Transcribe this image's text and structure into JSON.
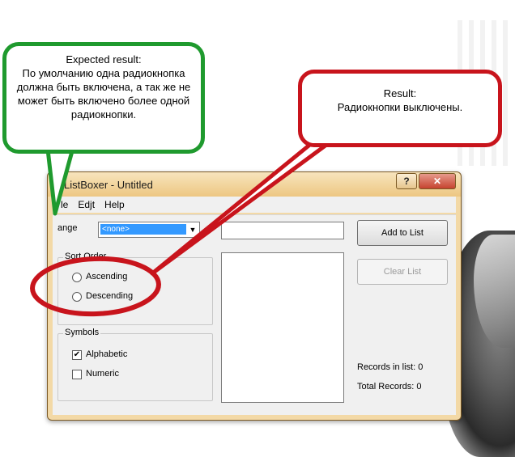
{
  "window": {
    "title": "ListBoxer - Untitled",
    "help_label": "?",
    "close_label": "✕",
    "menu": [
      {
        "label": "File",
        "visible_text": "le"
      },
      {
        "label": "Edit",
        "visible_text": "Edjt"
      },
      {
        "label": "Help",
        "visible_text": "Help"
      }
    ],
    "range_label": "ange",
    "range_value": "<none>",
    "sort_order": {
      "title": "Sort Order",
      "options": [
        "Ascending",
        "Descending"
      ]
    },
    "symbols": {
      "title": "Symbols",
      "options": [
        {
          "label": "Alphabetic",
          "checked": true
        },
        {
          "label": "Numeric",
          "checked": false
        }
      ]
    },
    "add_button": "Add to List",
    "clear_button": "Clear List",
    "records_in_list": "Records in list: 0",
    "total_records": "Total Records: 0"
  },
  "callouts": {
    "expected": {
      "title": "Expected result:",
      "text": "По умолчанию одна радиокнопка должна быть включена, а так же не может быть включено более одной радиокнопки."
    },
    "result": {
      "title": "Result:",
      "text": "Радиокнопки выключены."
    }
  },
  "colors": {
    "green": "#1f9a2e",
    "red": "#c8141c",
    "window_frame": "#f3d9a6"
  }
}
